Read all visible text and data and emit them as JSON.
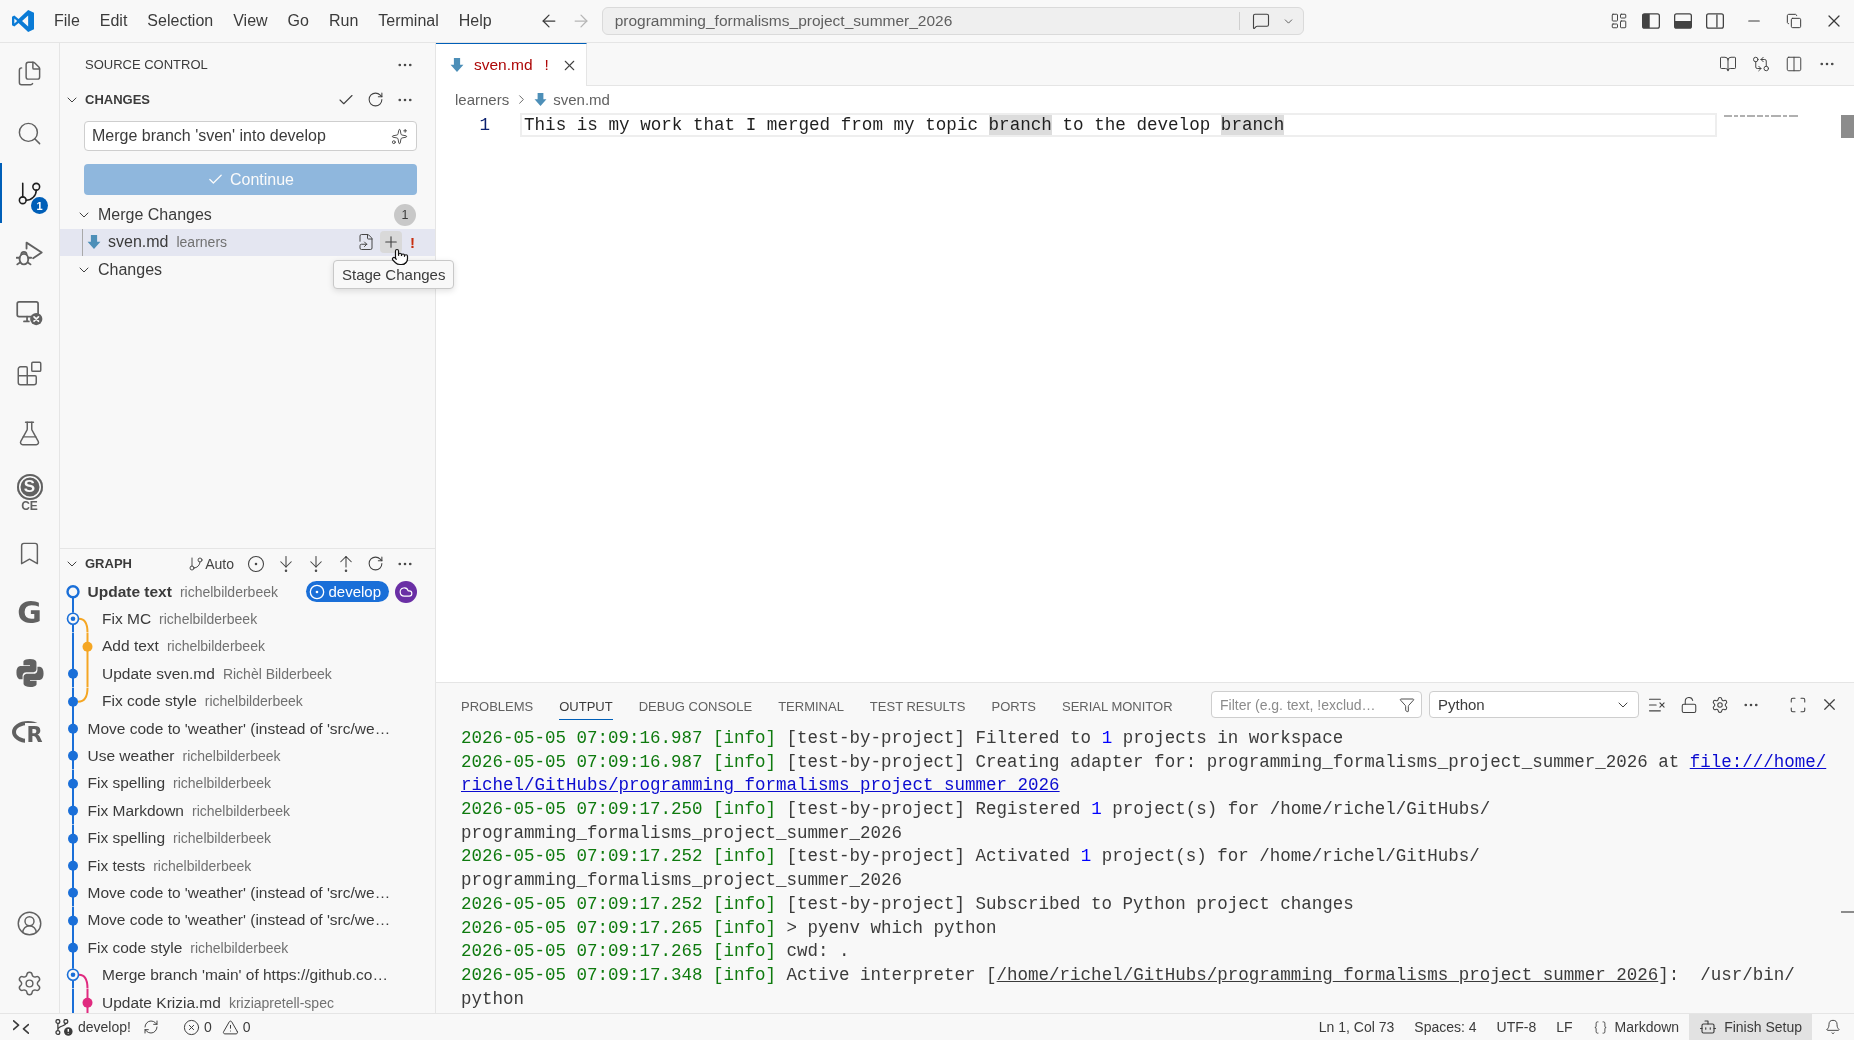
{
  "title_bar": {
    "menu": [
      "File",
      "Edit",
      "Selection",
      "View",
      "Go",
      "Run",
      "Terminal",
      "Help"
    ],
    "navigation": [
      {
        "kind": "back",
        "disabled": false
      },
      {
        "kind": "forward",
        "disabled": true
      }
    ],
    "command_center": "programming_formalisms_project_summer_2026",
    "layout_toggles": [
      {
        "kind": "primary-sidebar",
        "on": true
      },
      {
        "kind": "panel",
        "on": true
      },
      {
        "kind": "secondary-sidebar",
        "on": false
      }
    ]
  },
  "activity_bar": {
    "top": [
      {
        "kind": "explorer",
        "selected": false
      },
      {
        "kind": "search",
        "selected": false
      },
      {
        "kind": "source-control",
        "selected": true,
        "badge": "1"
      },
      {
        "kind": "run-debug",
        "selected": false
      },
      {
        "kind": "remote",
        "selected": false
      },
      {
        "kind": "extensions",
        "selected": false
      },
      {
        "kind": "testing",
        "selected": false
      },
      {
        "kind": "ring-logo",
        "selected": false,
        "letter": "S",
        "caption": "CE"
      },
      {
        "kind": "bookmarks",
        "selected": false
      },
      {
        "kind": "letter-logo",
        "selected": false,
        "letter": "G"
      },
      {
        "kind": "python",
        "selected": false
      },
      {
        "kind": "oval-logo",
        "selected": false,
        "letter": "R"
      }
    ],
    "bottom": [
      {
        "kind": "accounts"
      },
      {
        "kind": "manage"
      }
    ]
  },
  "sidebar": {
    "title": "SOURCE CONTROL",
    "changes": {
      "title": "CHANGES",
      "expanded": true,
      "message": {
        "value": "Merge branch 'sven' into develop"
      },
      "button": {
        "label": "Continue",
        "disabled": true
      },
      "groups": [
        {
          "label": "Merge Changes",
          "expanded": true,
          "count": "1",
          "files": [
            {
              "name": "sven.md",
              "folder": "learners",
              "status": "!",
              "selected": true
            }
          ]
        },
        {
          "label": "Changes",
          "expanded": true
        }
      ]
    },
    "tooltip": "Stage Changes",
    "graph": {
      "title": "GRAPH",
      "expanded": true,
      "mode": "Auto",
      "commits": [
        {
          "message": "Update text",
          "author": "richelbilderbeek",
          "kind": "head",
          "color": "#1a6fd8",
          "badges": [
            {
              "kind": "branch",
              "text": "develop",
              "color": "#1a6fd8"
            },
            {
              "kind": "remote",
              "color": "#6a2fa5"
            }
          ]
        },
        {
          "message": "Fix MC",
          "author": "richelbilderbeek",
          "kind": "merge",
          "color": "#1a6fd8"
        },
        {
          "message": "Add text",
          "author": "richelbilderbeek",
          "kind": "side",
          "color": "#f5a623"
        },
        {
          "message": "Update sven.md",
          "author": "Richèl Bilderbeek",
          "kind": "pass",
          "color": "#1a6fd8"
        },
        {
          "message": "Fix code style",
          "author": "richelbilderbeek",
          "kind": "join",
          "color": "#1a6fd8"
        },
        {
          "message": "Move code to 'weather' (instead of 'src/we…",
          "kind": "commit",
          "color": "#1a6fd8"
        },
        {
          "message": "Use weather",
          "author": "richelbilderbeek",
          "kind": "commit",
          "color": "#1a6fd8"
        },
        {
          "message": "Fix spelling",
          "author": "richelbilderbeek",
          "kind": "commit",
          "color": "#1a6fd8"
        },
        {
          "message": "Fix Markdown",
          "author": "richelbilderbeek",
          "kind": "commit",
          "color": "#1a6fd8"
        },
        {
          "message": "Fix spelling",
          "author": "richelbilderbeek",
          "kind": "commit",
          "color": "#1a6fd8"
        },
        {
          "message": "Fix tests",
          "author": "richelbilderbeek",
          "kind": "commit",
          "color": "#1a6fd8"
        },
        {
          "message": "Move code to 'weather' (instead of 'src/we…",
          "kind": "commit",
          "color": "#1a6fd8"
        },
        {
          "message": "Move code to 'weather' (instead of 'src/we…",
          "kind": "commit",
          "color": "#1a6fd8"
        },
        {
          "message": "Fix code style",
          "author": "richelbilderbeek",
          "kind": "commit",
          "color": "#1a6fd8"
        },
        {
          "message": "Merge branch 'main' of https://github.co…",
          "kind": "merge",
          "color": "#1a6fd8"
        },
        {
          "message": "Update Krizia.md",
          "author": "kriziapretell-spec",
          "kind": "side",
          "color": "#e02a7f"
        }
      ]
    }
  },
  "editor": {
    "tabs": [
      {
        "label": "sven.md",
        "status": "!",
        "selected": true
      }
    ],
    "breadcrumb": [
      {
        "kind": "folder",
        "text": "learners"
      },
      {
        "kind": "file",
        "text": "sven.md"
      }
    ],
    "lines": [
      {
        "number": "1",
        "segments": [
          {
            "text": "This is my work that I merged from my topic ",
            "highlighted": false
          },
          {
            "text": "branch",
            "highlighted": true
          },
          {
            "text": " to the develop ",
            "highlighted": false
          },
          {
            "text": "branch",
            "highlighted": true
          }
        ]
      }
    ]
  },
  "panel": {
    "tabs": [
      {
        "label": "PROBLEMS",
        "selected": false
      },
      {
        "label": "OUTPUT",
        "selected": true
      },
      {
        "label": "DEBUG CONSOLE",
        "selected": false
      },
      {
        "label": "TERMINAL",
        "selected": false
      },
      {
        "label": "TEST RESULTS",
        "selected": false
      },
      {
        "label": "PORTS",
        "selected": false
      },
      {
        "label": "SERIAL MONITOR",
        "selected": false
      }
    ],
    "filter": {
      "placeholder": "Filter (e.g. text, !exclud…"
    },
    "channel": "Python",
    "lines": [
      [
        {
          "kind": "stamp",
          "text": "2026-05-05 07:09:16.987 [info]"
        },
        {
          "kind": "text",
          "text": " [test-by-project] Filtered to "
        },
        {
          "kind": "number",
          "text": "1"
        },
        {
          "kind": "text",
          "text": " projects in workspace"
        }
      ],
      [
        {
          "kind": "stamp",
          "text": "2026-05-05 07:09:16.987 [info]"
        },
        {
          "kind": "text",
          "text": " [test-by-project] Creating adapter for: programming_formalisms_project_summer_2026 at "
        },
        {
          "kind": "link",
          "text": "file:///home/"
        }
      ],
      [
        {
          "kind": "link",
          "text": "richel/GitHubs/programming_formalisms_project_summer_2026"
        }
      ],
      [
        {
          "kind": "stamp",
          "text": "2026-05-05 07:09:17.250 [info]"
        },
        {
          "kind": "text",
          "text": " [test-by-project] Registered "
        },
        {
          "kind": "number",
          "text": "1"
        },
        {
          "kind": "text",
          "text": " project(s) for /home/richel/GitHubs/"
        }
      ],
      [
        {
          "kind": "text",
          "text": "programming_formalisms_project_summer_2026"
        }
      ],
      [
        {
          "kind": "stamp",
          "text": "2026-05-05 07:09:17.252 [info]"
        },
        {
          "kind": "text",
          "text": " [test-by-project] Activated "
        },
        {
          "kind": "number",
          "text": "1"
        },
        {
          "kind": "text",
          "text": " project(s) for /home/richel/GitHubs/"
        }
      ],
      [
        {
          "kind": "text",
          "text": "programming_formalisms_project_summer_2026"
        }
      ],
      [
        {
          "kind": "stamp",
          "text": "2026-05-05 07:09:17.252 [info]"
        },
        {
          "kind": "text",
          "text": " [test-by-project] Subscribed to Python project changes"
        }
      ],
      [
        {
          "kind": "stamp",
          "text": "2026-05-05 07:09:17.265 [info]"
        },
        {
          "kind": "text",
          "text": " > pyenv which python"
        }
      ],
      [
        {
          "kind": "stamp",
          "text": "2026-05-05 07:09:17.265 [info]"
        },
        {
          "kind": "text",
          "text": " cwd: ."
        }
      ],
      [
        {
          "kind": "stamp",
          "text": "2026-05-05 07:09:17.348 [info]"
        },
        {
          "kind": "text",
          "text": " Active interpreter ["
        },
        {
          "kind": "path",
          "text": "/home/richel/GitHubs/programming_formalisms_project_summer_2026"
        },
        {
          "kind": "text",
          "text": "]:  /usr/bin/"
        }
      ],
      [
        {
          "kind": "text",
          "text": "python"
        }
      ]
    ]
  },
  "status_bar": {
    "branch": "develop!",
    "problems": [
      {
        "kind": "error",
        "count": "0"
      },
      {
        "kind": "warning",
        "count": "0"
      }
    ],
    "items": [
      {
        "kind": "text",
        "text": "Ln 1, Col 73"
      },
      {
        "kind": "text",
        "text": "Spaces: 4"
      },
      {
        "kind": "text",
        "text": "UTF-8"
      },
      {
        "kind": "text",
        "text": "LF"
      },
      {
        "kind": "language",
        "text": "Markdown"
      },
      {
        "kind": "setup",
        "text": "Finish Setup"
      }
    ]
  }
}
